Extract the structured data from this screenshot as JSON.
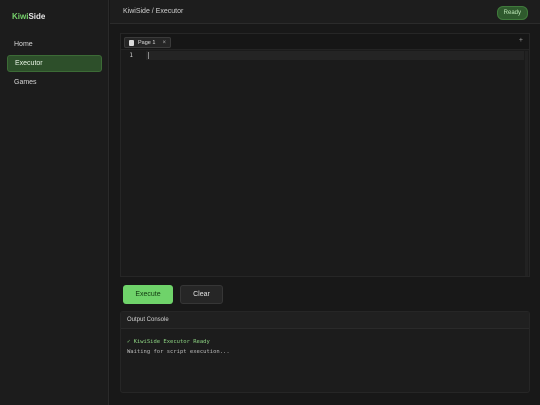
{
  "sidebar": {
    "brand_kiwi": "Kiwi",
    "brand_side": "Side",
    "items": [
      {
        "label": "Home"
      },
      {
        "label": "Executor"
      },
      {
        "label": "Games"
      }
    ]
  },
  "header": {
    "breadcrumb": "KiwiSide / Executor",
    "status": "Ready"
  },
  "editor": {
    "tabs": [
      {
        "label": "Page 1",
        "close": "×"
      }
    ],
    "add_tab": "+",
    "line_numbers": [
      "1"
    ]
  },
  "actions": {
    "execute_label": "Execute",
    "clear_label": "Clear"
  },
  "console": {
    "title": "Output Console",
    "lines": [
      "✓ KiwiSide Executor Ready",
      "Waiting for script execution..."
    ]
  },
  "colors": {
    "accent": "#6fd36a",
    "active_nav": "#2d4f2a",
    "background": "#171717"
  },
  "icons": {
    "tab_icon": "document-icon",
    "add_tab": "plus-icon",
    "tab_close": "close-icon"
  }
}
